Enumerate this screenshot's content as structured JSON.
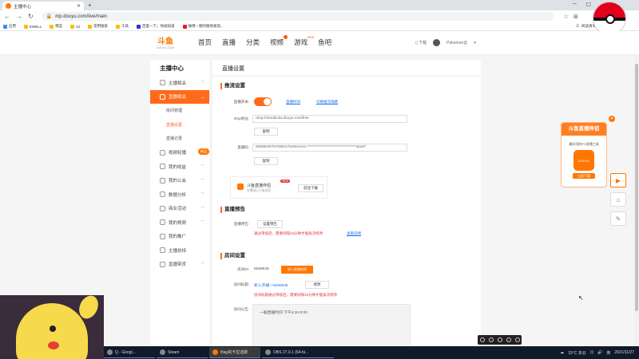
{
  "browser": {
    "tab_title": "主播中心",
    "url": "mp.douyu.com/live/main",
    "bookmarks": [
      "应用",
      "EWELL",
      "韩志",
      "txt",
      "常用搜索",
      "工具",
      "百度一下，你就知道",
      "微博－随时随地发现..."
    ],
    "reading_list": "阅读清单"
  },
  "site": {
    "logo_text": "斗鱼",
    "logo_sub": "DOUYU.COM",
    "nav": [
      "首页",
      "直播",
      "分类",
      "视频",
      "游戏",
      "鱼吧"
    ],
    "nav_badge": "NEW",
    "download": "下载",
    "username": "Pokemon云"
  },
  "sidebar": {
    "title": "主播中心",
    "items": [
      {
        "label": "主播相关"
      },
      {
        "label": "直播相关"
      },
      {
        "label": "房间管理"
      },
      {
        "label": "直播设置"
      },
      {
        "label": "直播记录"
      },
      {
        "label": "视频轮播"
      },
      {
        "label": "我的收益"
      },
      {
        "label": "我的公会"
      },
      {
        "label": "数据分析"
      },
      {
        "label": "商业活动"
      },
      {
        "label": "我的视频"
      },
      {
        "label": "我的推广"
      },
      {
        "label": "主播扶持"
      },
      {
        "label": "直播带货"
      }
    ],
    "new_badge": "新品"
  },
  "main": {
    "page_title": "直播设置",
    "stream": {
      "section": "推流设置",
      "switch_label": "直播开关:",
      "live_link": "直播时间",
      "replay_link": "切换推流线路",
      "rtmp_label": "rtmp地址:",
      "rtmp_value": "rtmp://sendtc3a.douyu.com/live",
      "copy": "复制",
      "code_label": "直播码:",
      "code_value": "9268845rTsY6Wm?wsSecret=*********************************&wsT",
      "companion_title": "斗鱼直播伴侣",
      "companion_sub": "仅需追1万推流员",
      "companion_new": "NEW",
      "companion_btn": "前往下载"
    },
    "preview": {
      "section": "直播预告",
      "label": "直播预告:",
      "btn": "设置预告",
      "warn": "通过审核后，需要间隔10分钟才能再次修改",
      "link": "查看说明"
    },
    "room": {
      "section": "房间设置",
      "id_label": "房间ID:",
      "id_value": "9268845",
      "enter_btn": "进入直播房间",
      "title_label": "房间标题:",
      "title_value": "新人开播～9268845",
      "modify": "修改",
      "title_warn": "房间标题通过审核后，需要间隔10分钟才能再次修改",
      "notice_label": "房间公告:",
      "notice_value": "一般直播时间 下午6:30-0:00"
    }
  },
  "promo": {
    "title": "斗鱼直播伴侣",
    "desc": "最好用的PC直播工具",
    "app_name": "DOUYU",
    "download": "立即下载"
  },
  "taskbar": {
    "items": [
      "Q - Googl...",
      "Steam",
      "ifiag央卡拉迪斯",
      "OBS 27.0.1 (64-bi..."
    ],
    "temp": "15°C 多云",
    "lang": "英",
    "date": "2021/11/27"
  }
}
